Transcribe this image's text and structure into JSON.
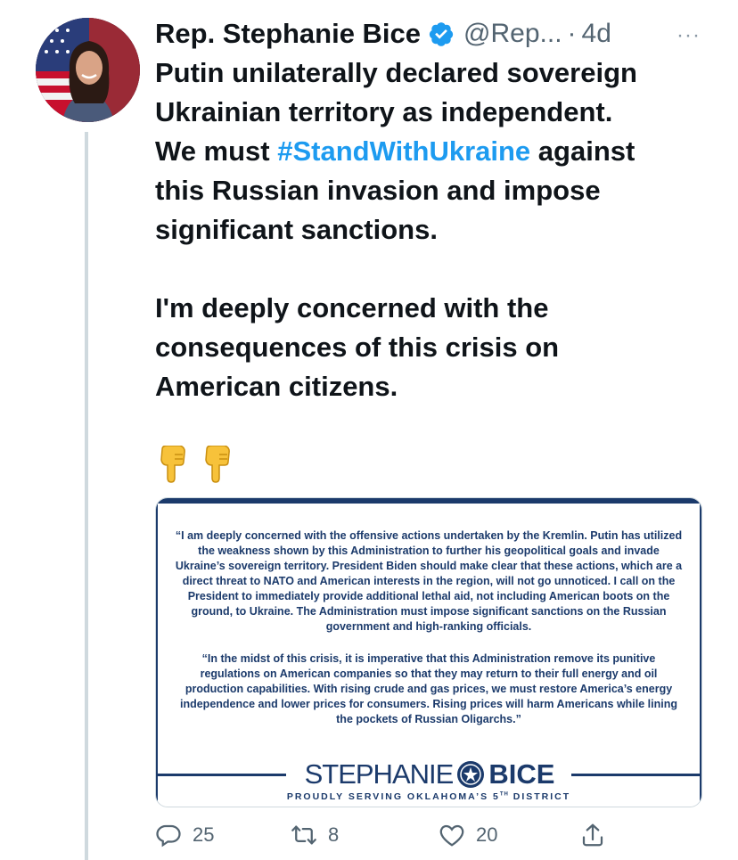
{
  "tweet": {
    "author_name": "Rep. Stephanie Bice",
    "author_handle": "@Rep...",
    "separator": "·",
    "time_ago": "4d",
    "more_label": "···",
    "text_line1_a": "Putin unilaterally declared sovereign",
    "text_line2": "Ukrainian territory as independent.",
    "text_line3_pre": "We must ",
    "hashtag": "#StandWithUkraine",
    "text_line3_post": " against",
    "text_line4": "this Russian invasion and impose",
    "text_line5": "significant sanctions.",
    "text_para2_line1": "I'm deeply concerned with the",
    "text_para2_line2": "consequences of this crisis on",
    "text_para2_line3": "American citizens.",
    "emojis": "👇👇"
  },
  "statement": {
    "quote1": "“I am deeply concerned with the offensive actions undertaken by the Kremlin. Putin has utilized the weakness shown by this Administration to further his geopolitical goals and invade Ukraine’s sovereign territory. President Biden should make clear that these actions, which are a direct threat to NATO and American interests in the region, will not go unnoticed. I call on the President to immediately provide additional lethal aid, not including American boots on the ground, to Ukraine. The Administration must impose significant sanctions on the Russian government and high-ranking officials.",
    "quote2": "“In the midst of this crisis, it is imperative that this Administration remove its punitive regulations on American companies so that they may return to their full energy and oil production capabilities. With rising crude and gas prices, we must restore America’s energy independence and lower prices for consumers. Rising prices will harm Americans while lining the pockets of Russian Oligarchs.”",
    "signature_first": "STEPHANIE",
    "signature_last": "BICE",
    "tagline_pre": "PROUDLY SERVING OKLAHOMA’S 5",
    "tagline_sup": "TH",
    "tagline_post": " DISTRICT"
  },
  "actions": {
    "reply_count": "25",
    "retweet_count": "8",
    "like_count": "20"
  },
  "colors": {
    "brand_blue": "#1d9bf0",
    "statement_navy": "#1b3a6b",
    "secondary_text": "#536471"
  },
  "icons": [
    "verified-badge-icon",
    "more-icon",
    "reply-icon",
    "retweet-icon",
    "like-icon",
    "share-icon",
    "seal-icon"
  ]
}
